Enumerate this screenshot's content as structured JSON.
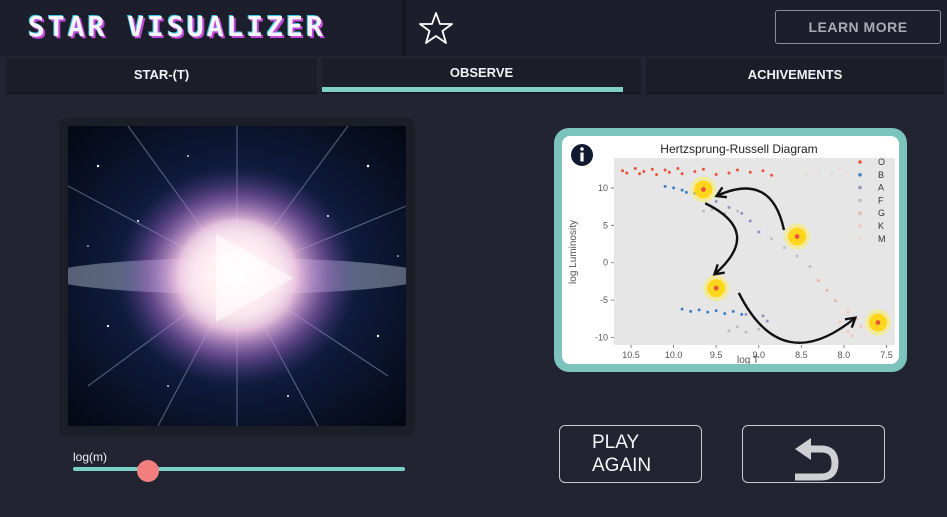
{
  "header": {
    "title": "STAR VISUALIZER",
    "favorite_icon": "star-outline-icon",
    "learn_more_label": "LEARN MORE"
  },
  "tabs": [
    {
      "label": "STAR-(T)",
      "active": false
    },
    {
      "label": "OBSERVE",
      "active": true
    },
    {
      "label": "ACHIVEMENTS",
      "active": false
    }
  ],
  "video": {
    "play_icon": "play-icon"
  },
  "slider": {
    "label": "log(m)",
    "value_fraction": 0.23
  },
  "hr_diagram": {
    "info_icon": "info-icon",
    "chart_data": {
      "type": "scatter",
      "title": "Hertzsprung-Russell Diagram",
      "xlabel": "log T",
      "ylabel": "log Luminosity",
      "xlim": [
        10.7,
        7.4
      ],
      "ylim": [
        -11,
        14
      ],
      "x_reversed": true,
      "xticks": [
        "10.5",
        "10.0",
        "9.5",
        "9.0",
        "8.5",
        "8.0",
        "7.5"
      ],
      "yticks": [
        "10",
        "5",
        "0",
        "-5",
        "-10"
      ],
      "legend": {
        "placement": "top-right",
        "entries": [
          "O",
          "B",
          "A",
          "F",
          "G",
          "K",
          "M"
        ]
      },
      "colors": {
        "O": "#e8543c",
        "B": "#3f82c6",
        "A": "#9b8fc0",
        "F": "#bfbfbf",
        "G": "#e4b8a8",
        "K": "#f2c6ba",
        "M": "#ead7d4"
      },
      "series": [
        {
          "name": "O",
          "points": [
            [
              10.6,
              12.3
            ],
            [
              10.55,
              12.0
            ],
            [
              10.45,
              12.6
            ],
            [
              10.4,
              11.9
            ],
            [
              10.35,
              12.2
            ],
            [
              10.25,
              12.5
            ],
            [
              10.2,
              11.8
            ],
            [
              10.1,
              12.4
            ],
            [
              10.05,
              12.1
            ],
            [
              9.95,
              12.6
            ],
            [
              9.9,
              11.9
            ],
            [
              9.75,
              12.2
            ],
            [
              9.65,
              12.5
            ],
            [
              9.5,
              11.8
            ],
            [
              9.35,
              12.0
            ],
            [
              9.25,
              12.4
            ],
            [
              9.1,
              12.1
            ],
            [
              8.95,
              12.3
            ],
            [
              8.85,
              11.7
            ]
          ]
        },
        {
          "name": "B",
          "points": [
            [
              10.1,
              10.2
            ],
            [
              10.0,
              10.0
            ],
            [
              9.9,
              9.7
            ],
            [
              9.85,
              9.4
            ],
            [
              9.75,
              9.3
            ],
            [
              9.9,
              -6.2
            ],
            [
              9.8,
              -6.5
            ],
            [
              9.7,
              -6.3
            ],
            [
              9.6,
              -6.6
            ],
            [
              9.5,
              -6.4
            ],
            [
              9.4,
              -6.8
            ],
            [
              9.3,
              -6.5
            ],
            [
              9.2,
              -6.9
            ]
          ]
        },
        {
          "name": "A",
          "points": [
            [
              9.5,
              8.2
            ],
            [
              9.35,
              7.4
            ],
            [
              9.2,
              6.6
            ],
            [
              9.1,
              5.6
            ],
            [
              9.0,
              4.1
            ],
            [
              9.15,
              -6.9
            ],
            [
              9.05,
              -7.4
            ],
            [
              8.95,
              -7.1
            ],
            [
              8.9,
              -7.8
            ]
          ]
        },
        {
          "name": "F",
          "points": [
            [
              9.65,
              6.9
            ],
            [
              9.55,
              7.1
            ],
            [
              9.4,
              6.6
            ],
            [
              9.25,
              6.9
            ],
            [
              8.85,
              3.2
            ],
            [
              8.7,
              2.0
            ],
            [
              8.55,
              0.9
            ],
            [
              8.4,
              -0.5
            ],
            [
              9.25,
              -8.6
            ],
            [
              9.15,
              -9.3
            ],
            [
              9.0,
              -8.9
            ],
            [
              9.35,
              -9.1
            ]
          ]
        },
        {
          "name": "G",
          "points": [
            [
              8.3,
              -2.4
            ],
            [
              8.2,
              -3.7
            ],
            [
              8.1,
              -5.1
            ]
          ]
        },
        {
          "name": "K",
          "points": [
            [
              7.95,
              -6.6
            ],
            [
              7.85,
              -7.5
            ],
            [
              7.8,
              -8.5
            ],
            [
              7.95,
              -9.2
            ],
            [
              8.05,
              -7.9
            ],
            [
              7.9,
              -9.8
            ]
          ]
        },
        {
          "name": "M",
          "points": [
            [
              8.45,
              11.8
            ],
            [
              8.3,
              12.3
            ],
            [
              8.15,
              11.9
            ],
            [
              8.05,
              12.5
            ],
            [
              7.95,
              -6.1
            ],
            [
              8.1,
              -9.1
            ],
            [
              7.75,
              -9.7
            ]
          ]
        }
      ],
      "highlighted_stars": [
        [
          9.65,
          9.8
        ],
        [
          8.55,
          3.5
        ],
        [
          9.5,
          -3.4
        ],
        [
          7.6,
          -8.0
        ]
      ],
      "arrows": [
        {
          "from": [
            8.55,
            3.5
          ],
          "to": [
            9.65,
            9.8
          ]
        },
        {
          "from": [
            9.65,
            9.8
          ],
          "to": [
            9.5,
            -3.4
          ]
        },
        {
          "from": [
            9.5,
            -3.4
          ],
          "to": [
            7.6,
            -8.0
          ]
        }
      ]
    }
  },
  "buttons": {
    "play_again_line1": "PLAY",
    "play_again_line2": "AGAIN",
    "undo_icon": "undo-icon"
  }
}
